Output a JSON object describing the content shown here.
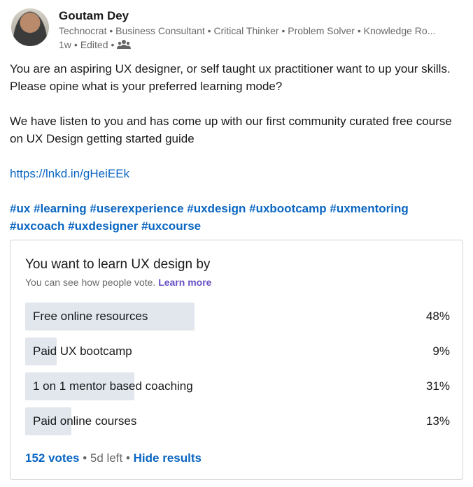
{
  "author": {
    "name": "Goutam Dey",
    "headline": "Technocrat • Business Consultant • Critical Thinker • Problem Solver • Knowledge Ro...",
    "time": "1w",
    "edited": "Edited",
    "sep": "•",
    "visibility_icon": "connections-icon"
  },
  "post": {
    "para1": "You are an aspiring UX designer, or self taught ux practitioner want to up your skills. Please opine what is your preferred learning mode?",
    "para2": "We have listen to you and has come up with our first community curated free course on UX Design getting started guide",
    "link": "https://lnkd.in/gHeiEEk",
    "hashtags": [
      "#ux",
      "#learning",
      "#userexperience",
      "#uxdesign",
      "#uxbootcamp",
      "#uxmentoring",
      "#uxcoach",
      "#uxdesigner",
      "#uxcourse"
    ]
  },
  "poll": {
    "question": "You want to learn UX design by",
    "note": "You can see how people vote.",
    "learn_more": "Learn more",
    "options": [
      {
        "label": "Free online resources",
        "percent": "48%",
        "fraction": 0.48
      },
      {
        "label": "Paid UX bootcamp",
        "percent": "9%",
        "fraction": 0.09
      },
      {
        "label": "1 on 1 mentor based coaching",
        "percent": "31%",
        "fraction": 0.31
      },
      {
        "label": "Paid online courses",
        "percent": "13%",
        "fraction": 0.13
      }
    ],
    "votes": "152 votes",
    "sep": "•",
    "time_left": "5d left",
    "hide_results": "Hide results"
  },
  "colors": {
    "link": "#0a66c2",
    "bar": "#e1e7ed",
    "learn_more": "#6a50c4"
  }
}
